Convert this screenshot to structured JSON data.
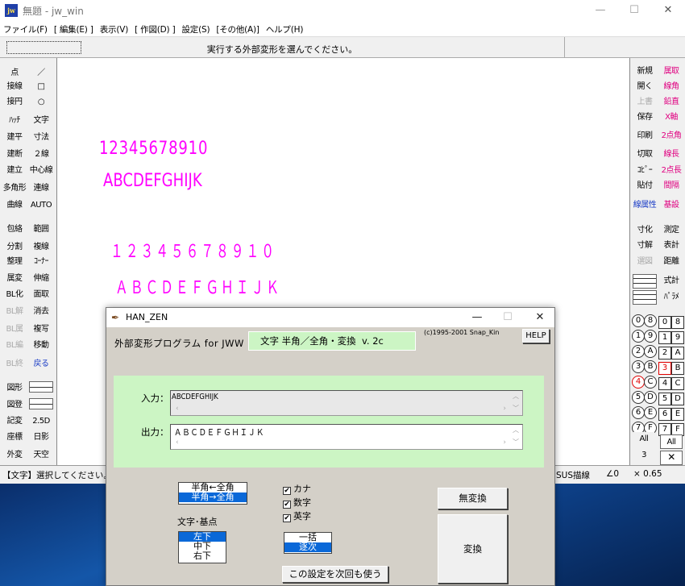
{
  "window": {
    "title": "無題 - jw_win",
    "app_icon": "jw",
    "minimize": "—",
    "maximize": "☐",
    "close": "✕"
  },
  "menu": [
    "ファイル(F)",
    "[ 編集(E) ]",
    "表示(V)",
    "[ 作図(D) ]",
    "設定(S)",
    "[その他(A)]",
    "ヘルプ(H)"
  ],
  "message": "実行する外部変形を選んでください。",
  "left_tools": [
    [
      "点",
      "／"
    ],
    [
      "接線",
      "□"
    ],
    [
      "接円",
      "○"
    ],
    [
      "ﾊｯﾁ",
      "文字"
    ],
    [
      "建平",
      "寸法"
    ],
    [
      "建断",
      "２線"
    ],
    [
      "建立",
      "中心線"
    ],
    [
      "多角形",
      "連線"
    ],
    [
      "曲線",
      "AUTO"
    ],
    [
      "包絡",
      "範囲"
    ],
    [
      "分割",
      "複線"
    ],
    [
      "整理",
      "ｺｰﾅｰ"
    ],
    [
      "属変",
      "伸縮"
    ],
    [
      "BL化",
      "面取"
    ],
    [
      "BL解",
      "消去"
    ],
    [
      "BL属",
      "複写"
    ],
    [
      "BL編",
      "移動"
    ],
    [
      "BL終",
      "戻る"
    ],
    [
      "図形",
      ""
    ],
    [
      "図登",
      ""
    ],
    [
      "記変",
      "2.5D"
    ],
    [
      "座標",
      "日影"
    ],
    [
      "外変",
      "天空"
    ]
  ],
  "right_tools": [
    [
      "新規",
      "属取"
    ],
    [
      "開く",
      "線角"
    ],
    [
      "上書",
      "鉛直"
    ],
    [
      "保存",
      "X軸"
    ],
    [
      "印刷",
      "2点角"
    ],
    [
      "切取",
      "線長"
    ],
    [
      "ｺﾋﾟｰ",
      "2点長"
    ],
    [
      "貼付",
      "間隔"
    ],
    [
      "線属性",
      "基設"
    ],
    [
      "寸化",
      "測定"
    ],
    [
      "寸解",
      "表計"
    ],
    [
      "選図",
      "距離"
    ],
    [
      "",
      "式計"
    ],
    [
      "",
      "ﾊﾟﾗﾒ"
    ]
  ],
  "layer_circles": [
    "0",
    "1",
    "2",
    "3",
    "4",
    "5",
    "6",
    "7"
  ],
  "layer_circles_right": [
    "8",
    "9",
    "A",
    "B",
    "C",
    "D",
    "E",
    "F"
  ],
  "layer_squares_left": [
    "0",
    "1",
    "2",
    "3",
    "4",
    "5",
    "6",
    "7"
  ],
  "layer_squares_right": [
    "8",
    "9",
    "A",
    "B",
    "C",
    "D",
    "E",
    "F"
  ],
  "layer_all_left": "All",
  "layer_all_right": "All",
  "layer_num": "3",
  "layer_x": "✕",
  "canvas_text": [
    "12345678910",
    "ABCDEFGHIJK",
    "１２３４５６７８９１０",
    "ＡＢＣＤＥＦＧＨＩＪＫ"
  ],
  "status": {
    "left": "【文字】選択してください。",
    "mid": "SUS描線",
    "angle": "∠0",
    "scale": "× 0.65"
  },
  "dialog": {
    "title": "HAN_ZEN",
    "minimize": "—",
    "maximize": "☐",
    "close": "✕",
    "program_label": "外部変形プログラム for JWW",
    "name_box": "文字 半角／全角・変換  v. 2c",
    "copyright": "(c)1995-2001 Snap_Kin",
    "help": "HELP",
    "input_label": "入力：",
    "input_value": "ABCDEFGHIJK",
    "output_label": "出力：",
    "output_value": "ＡＢＣＤＥＦＧＨＩＪＫ",
    "mode_options": [
      "半角←全角",
      "半角→全角"
    ],
    "mode_selected": 1,
    "base_label": "文字･基点",
    "base_options": [
      "左下",
      "中下",
      "右下"
    ],
    "base_selected": 0,
    "checks": [
      {
        "label": "カナ",
        "checked": true
      },
      {
        "label": "数字",
        "checked": true
      },
      {
        "label": "英字",
        "checked": true
      }
    ],
    "check_mark": "✔",
    "batch_options": [
      "一括",
      "逐次"
    ],
    "batch_selected": 1,
    "save_setting": "この設定を次回も使う",
    "no_convert": "無変換",
    "convert": "変換"
  }
}
